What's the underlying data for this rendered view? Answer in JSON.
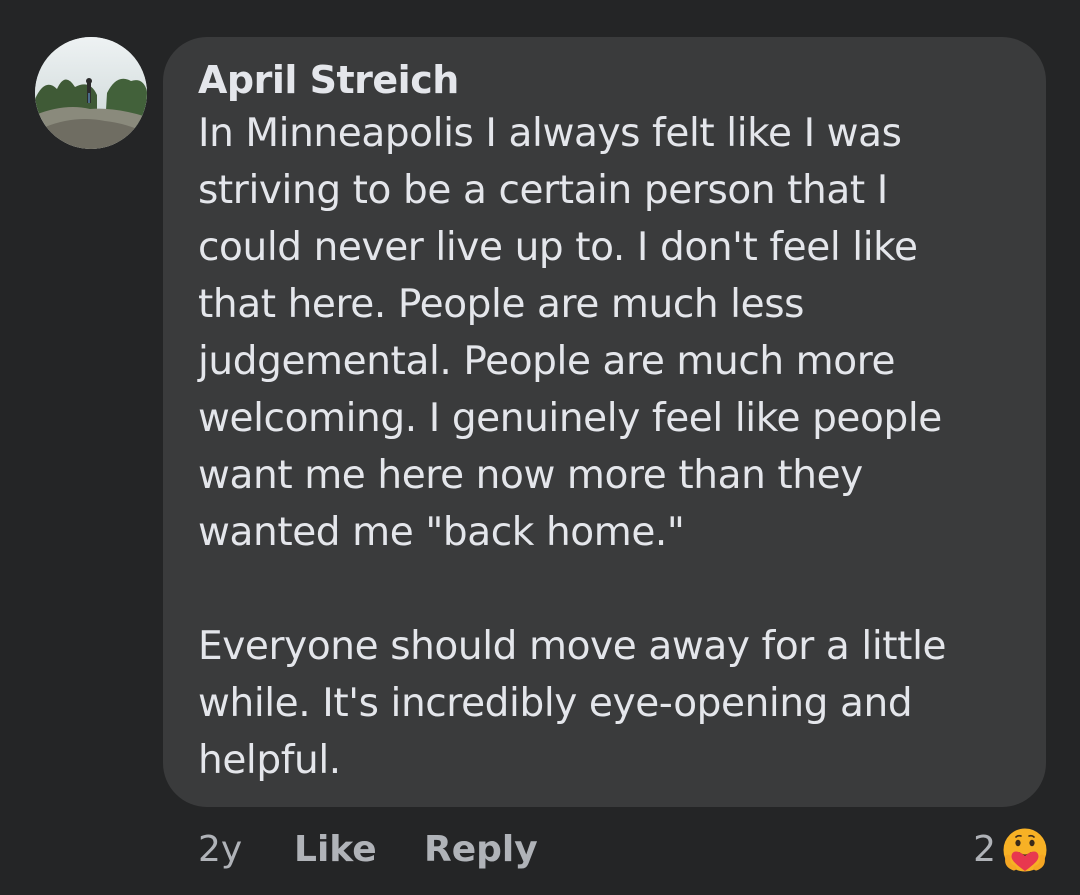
{
  "comment": {
    "author": "April Streich",
    "paragraphs": [
      [
        "In Minneapolis I always felt like I was",
        "striving to be a certain person that I",
        "could never live up to. I don't feel like",
        "that here. People are much less",
        "judgemental. People are much more",
        "welcoming. I genuinely feel like people",
        "want me here now more than they",
        "wanted me \"back home.\""
      ],
      [
        "Everyone should move away for a little",
        "while. It's incredibly eye-opening and",
        "helpful."
      ]
    ],
    "avatar_icon": "profile-photo-landscape",
    "bubble_color": "#3a3b3c"
  },
  "actions": {
    "time": "2y",
    "like_label": "Like",
    "reply_label": "Reply",
    "reaction_count": "2",
    "reaction_icon": "care-emoji-icon"
  }
}
